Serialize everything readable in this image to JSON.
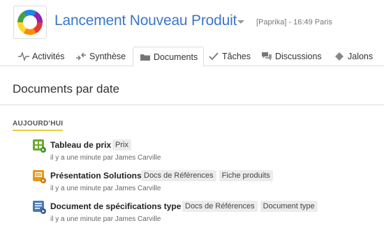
{
  "project": {
    "title": "Lancement Nouveau Produit",
    "meta": "[Paprika] - 16:49 Paris"
  },
  "tabs": [
    {
      "label": "Activités",
      "icon": "activity-icon"
    },
    {
      "label": "Synthèse",
      "icon": "arrows-icon"
    },
    {
      "label": "Documents",
      "icon": "folder-icon",
      "active": true
    },
    {
      "label": "Tâches",
      "icon": "checkmark-icon"
    },
    {
      "label": "Discussions",
      "icon": "chat-bubbles-icon"
    },
    {
      "label": "Jalons",
      "icon": "diamond-icon"
    }
  ],
  "page": {
    "title": "Documents par date"
  },
  "section": {
    "label": "AUJOURD'HUI"
  },
  "documents": [
    {
      "name": "Tableau de prix",
      "icon": "spreadsheet-icon",
      "tags": [
        "Prix"
      ],
      "meta": "il y a une minute par James Carville"
    },
    {
      "name": "Présentation Solutions",
      "icon": "presentation-icon",
      "tags": [
        "Docs de Références",
        "Fiche produits"
      ],
      "meta": "il y a une minute par James Carville"
    },
    {
      "name": "Document de spécifications type",
      "icon": "text-document-icon",
      "tags": [
        "Docs de Références",
        "Document type"
      ],
      "meta": "il y a une minute par James Carville"
    }
  ],
  "colors": {
    "title_blue": "#3a77c9",
    "section_underline": "#e7cf3f",
    "spreadsheet_green": "#6aaa2e",
    "presentation_orange": "#e8961c",
    "document_blue": "#4a78b5"
  }
}
